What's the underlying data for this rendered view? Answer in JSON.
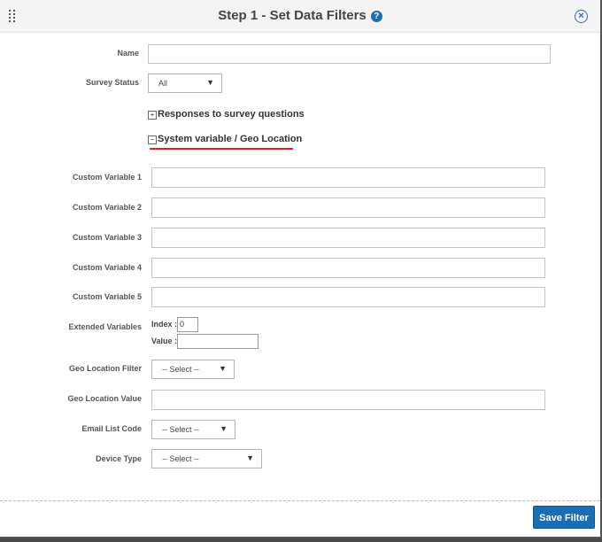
{
  "dialog": {
    "title": "Step 1 - Set Data Filters",
    "help_icon": "?",
    "close_icon": "×"
  },
  "fields": {
    "name_label": "Name",
    "survey_status_label": "Survey Status",
    "survey_status_value": "All",
    "responses_section": "Responses to survey questions",
    "system_section": "System variable / Geo Location",
    "custom_variable_1": "Custom Variable 1",
    "custom_variable_2": "Custom Variable 2",
    "custom_variable_3": "Custom Variable 3",
    "custom_variable_4": "Custom Variable 4",
    "custom_variable_5": "Custom Variable 5",
    "extended_variables_label": "Extended Variables",
    "index_label": "Index :",
    "index_value": "0",
    "value_label": "Value :",
    "geo_filter_label": "Geo Location Filter",
    "geo_filter_value": "-- Select --",
    "geo_value_label": "Geo Location Value",
    "email_list_label": "Email List Code",
    "email_list_value": "-- Select --",
    "device_type_label": "Device Type",
    "device_type_value": "-- Select --"
  },
  "footer": {
    "save_label": "Save Filter"
  },
  "colors": {
    "accent": "#1a6fb4",
    "highlight_underline": "#e02020"
  },
  "icons": {
    "drag": "drag-handle-icon",
    "help": "help-icon",
    "close": "close-icon",
    "expand": "plus-box-icon",
    "collapse": "minus-box-icon",
    "dropdown": "caret-down-icon"
  }
}
